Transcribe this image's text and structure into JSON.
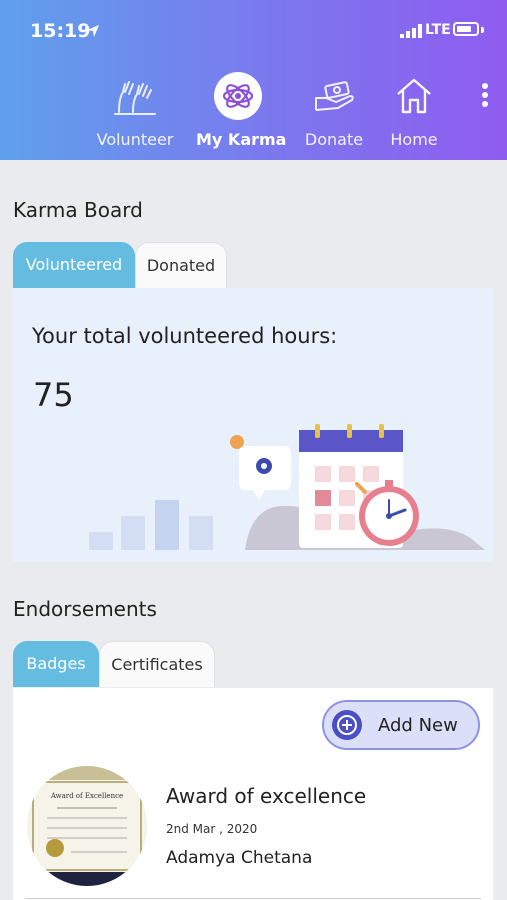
{
  "status_bar": {
    "time": "15:19",
    "network": "LTE"
  },
  "nav": {
    "items": [
      {
        "label": "Volunteer",
        "icon": "volunteer-hands-icon",
        "active": false
      },
      {
        "label": "My Karma",
        "icon": "atom-icon",
        "active": true
      },
      {
        "label": "Donate",
        "icon": "donate-hand-icon",
        "active": false
      },
      {
        "label": "Home",
        "icon": "home-icon",
        "active": false
      }
    ],
    "more_icon": "more-vertical-icon"
  },
  "karma_board": {
    "title": "Karma Board",
    "tabs": [
      {
        "label": "Volunteered",
        "active": true
      },
      {
        "label": "Donated",
        "active": false
      }
    ],
    "total_label": "Your total volunteered hours:",
    "total_value": "75"
  },
  "endorsements": {
    "title": "Endorsements",
    "tabs": [
      {
        "label": "Badges",
        "active": true
      },
      {
        "label": "Certificates",
        "active": false
      }
    ],
    "add_new_label": "Add New",
    "award": {
      "title": "Award of excellence",
      "date": "2nd Mar , 2020",
      "recipient": "Adamya Chetana",
      "image_text": "Award of Excellence"
    }
  },
  "colors": {
    "header_start": "#5fa0ec",
    "header_end": "#8f5cf0",
    "tab_active": "#64bce0",
    "panel_bg": "#e8f0fb",
    "accent": "#4b4fc7"
  }
}
